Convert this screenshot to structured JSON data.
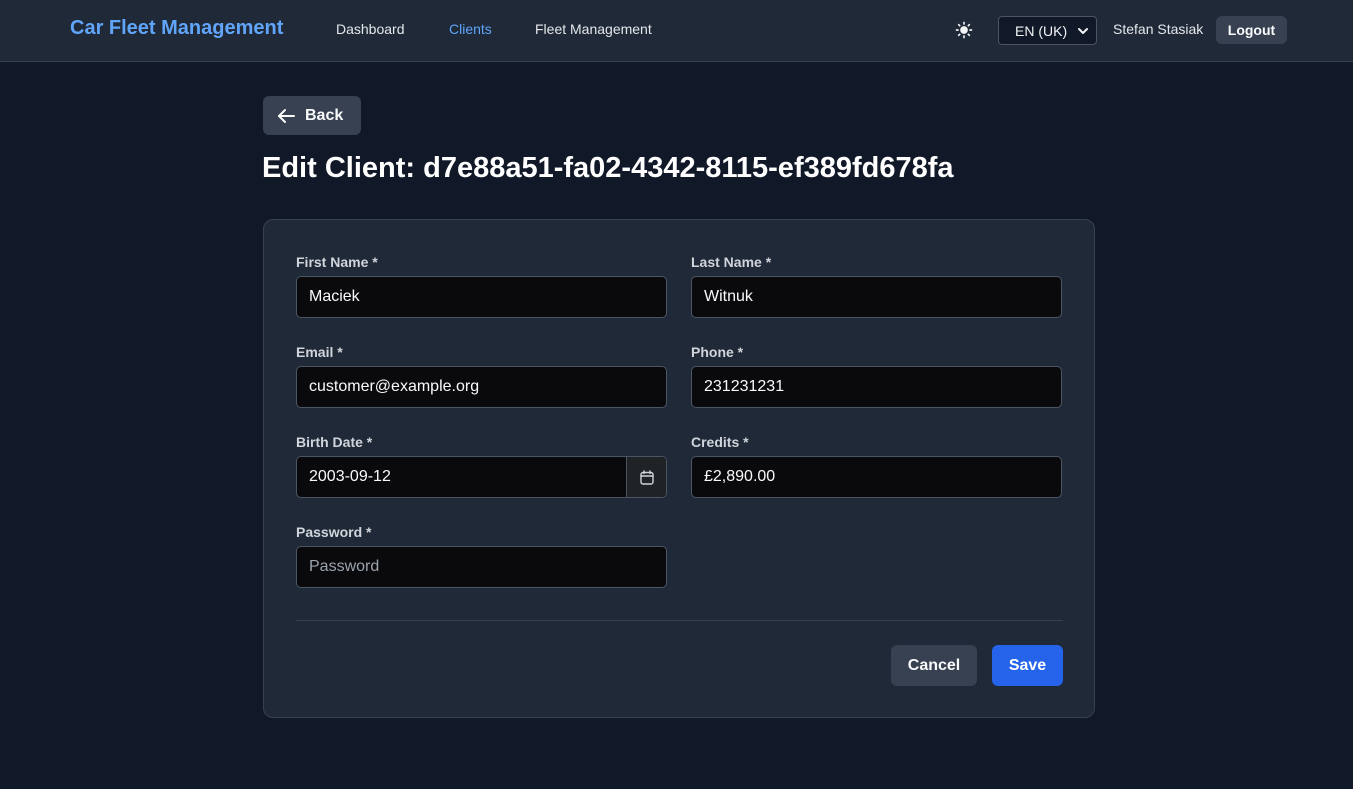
{
  "navbar": {
    "brand": "Car Fleet Management",
    "links": [
      {
        "label": "Dashboard",
        "active": false
      },
      {
        "label": "Clients",
        "active": true
      },
      {
        "label": "Fleet Management",
        "active": false
      }
    ],
    "theme_icon": "sun-icon",
    "language": "EN (UK)",
    "user_name": "Stefan Stasiak",
    "logout_label": "Logout"
  },
  "back_label": "Back",
  "page_title": "Edit Client: d7e88a51-fa02-4342-8115-ef389fd678fa",
  "form": {
    "first_name": {
      "label": "First Name *",
      "value": "Maciek"
    },
    "last_name": {
      "label": "Last Name *",
      "value": "Witnuk"
    },
    "email": {
      "label": "Email *",
      "value": "customer@example.org"
    },
    "phone": {
      "label": "Phone *",
      "value": "231231231"
    },
    "birth_date": {
      "label": "Birth Date *",
      "value": "2003-09-12",
      "icon": "calendar-icon"
    },
    "credits": {
      "label": "Credits *",
      "value": "£2,890.00"
    },
    "password": {
      "label": "Password *",
      "value": "",
      "placeholder": "Password"
    }
  },
  "actions": {
    "cancel_label": "Cancel",
    "save_label": "Save"
  },
  "colors": {
    "background": "#111827",
    "navbar": "#1f2937",
    "accent": "#60a5fa",
    "primary_button": "#2563eb"
  }
}
